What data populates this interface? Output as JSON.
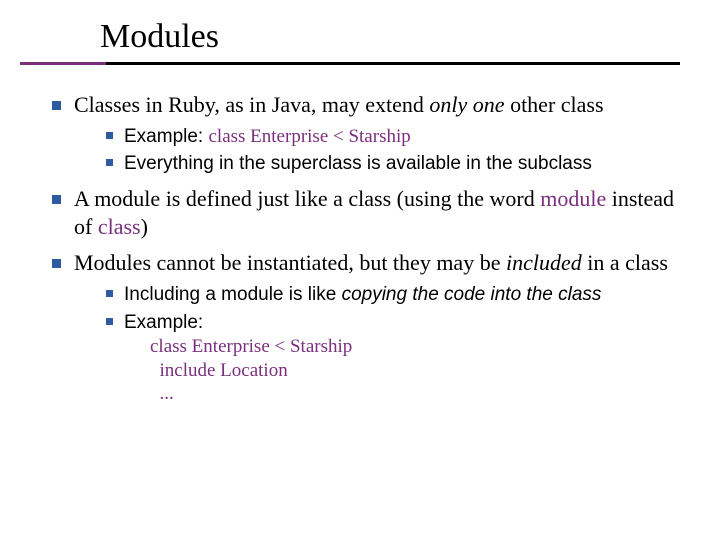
{
  "title": "Modules",
  "bullets": {
    "b1_pre": "Classes in Ruby, as in Java, may extend ",
    "b1_em": "only one",
    "b1_post": " other class",
    "b1_sub1_pre": "Example:  ",
    "b1_sub1_code": "class Enterprise < Starship",
    "b1_sub2": "Everything in the superclass is available in the subclass",
    "b2_pre": "A ",
    "b2_word": "module",
    "b2_mid": " is defined just like a class (using the word ",
    "b2_code1": "module",
    "b2_mid2": " instead of ",
    "b2_code2": "class",
    "b2_post": ")",
    "b3_pre": "Modules cannot be instantiated, but they may be ",
    "b3_em": "included",
    "b3_post": " in a class",
    "b3_sub1_pre": "Including a module is like ",
    "b3_sub1_em": "copying the code into the class",
    "b3_sub2_label": "Example:",
    "b3_code_line1": "class Enterprise < Starship",
    "b3_code_line2": "  include Location",
    "b3_code_line3": "  ..."
  }
}
